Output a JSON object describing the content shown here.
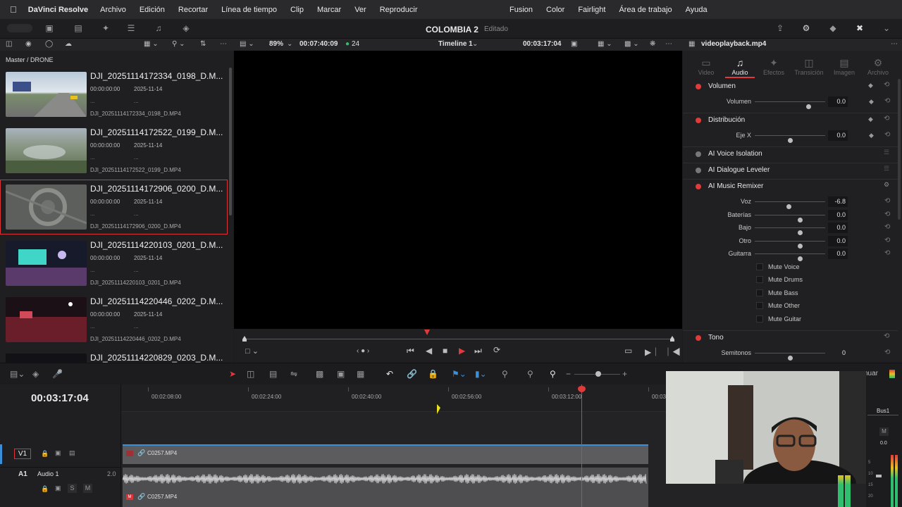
{
  "menubar": {
    "apple": "",
    "app": "DaVinci Resolve",
    "left_items": [
      "Archivo",
      "Edición",
      "Recortar",
      "Línea de tiempo",
      "Clip",
      "Marcar",
      "Ver",
      "Reproducir"
    ],
    "right_items": [
      "Fusion",
      "Color",
      "Fairlight",
      "Área de trabajo",
      "Ayuda"
    ]
  },
  "project": {
    "title": "COLOMBIA 2",
    "state": "Editado"
  },
  "viewer_bar": {
    "zoom": "89%",
    "source_tc": "00:07:40:09",
    "fps": "24",
    "timeline_name": "Timeline 1",
    "record_tc": "00:03:17:04",
    "clip_name": "videoplayback.mp4"
  },
  "mediapool": {
    "path": "Master / DRONE",
    "clips": [
      {
        "name": "DJI_20251114172334_0198_D.M...",
        "tc": "00:00:00:00",
        "date": "2025-11-14",
        "dash1": "...",
        "dash2": "...",
        "file": "DJI_20251114172334_0198_D.MP4",
        "selected": false
      },
      {
        "name": "DJI_20251114172522_0199_D.M...",
        "tc": "00:00:00:00",
        "date": "2025-11-14",
        "dash1": "...",
        "dash2": "...",
        "file": "DJI_20251114172522_0199_D.MP4",
        "selected": false
      },
      {
        "name": "DJI_20251114172906_0200_D.M...",
        "tc": "00:00:00:00",
        "date": "2025-11-14",
        "dash1": "...",
        "dash2": "...",
        "file": "DJI_20251114172906_0200_D.MP4",
        "selected": true
      },
      {
        "name": "DJI_20251114220103_0201_D.M...",
        "tc": "00:00:00:00",
        "date": "2025-11-14",
        "dash1": "...",
        "dash2": "...",
        "file": "DJI_20251114220103_0201_D.MP4",
        "selected": false
      },
      {
        "name": "DJI_20251114220446_0202_D.M...",
        "tc": "00:00:00:00",
        "date": "2025-11-14",
        "dash1": "...",
        "dash2": "...",
        "file": "DJI_20251114220446_0202_D.MP4",
        "selected": false
      },
      {
        "name": "DJI_20251114220829_0203_D.M...",
        "tc": "",
        "date": "",
        "dash1": "",
        "dash2": "",
        "file": "",
        "selected": false
      }
    ]
  },
  "inspector": {
    "tabs": [
      "Video",
      "Audio",
      "Efectos",
      "Transición",
      "Imagen",
      "Archivo"
    ],
    "active_tab": "Audio",
    "sections": {
      "volumen": {
        "title": "Volumen",
        "param": "Volumen",
        "value": "0.0",
        "level": 0.76
      },
      "distribucion": {
        "title": "Distribución",
        "param": "Eje X",
        "value": "0.0",
        "level": 0.5
      },
      "voice_isolation": "AI Voice Isolation",
      "dialogue_leveler": "AI Dialogue Leveler",
      "music_remixer": {
        "title": "AI Music Remixer",
        "params": [
          {
            "label": "Voz",
            "value": "-6.8",
            "level": 0.48
          },
          {
            "label": "Baterías",
            "value": "0.0",
            "level": 0.64
          },
          {
            "label": "Bajo",
            "value": "0.0",
            "level": 0.64
          },
          {
            "label": "Otro",
            "value": "0.0",
            "level": 0.64
          },
          {
            "label": "Guitarra",
            "value": "0.0",
            "level": 0.64
          }
        ],
        "mutes": [
          "Mute Voice",
          "Mute Drums",
          "Mute Bass",
          "Mute Other",
          "Mute Guitar"
        ]
      },
      "tono": {
        "title": "Tono",
        "param": "Semitonos",
        "value": "0",
        "level": 0.5
      }
    }
  },
  "timeline": {
    "timecode": "00:03:17:04",
    "ruler": [
      "00:02:08:00",
      "00:02:24:00",
      "00:02:40:00",
      "00:02:56:00",
      "00:03:12:00",
      "00:03"
    ],
    "video_track": {
      "id": "V1",
      "clip": "C0257.MP4"
    },
    "audio_track": {
      "id": "A1",
      "name": "Audio 1",
      "gain": "2.0",
      "clip": "C0257.MP4",
      "solo": "S",
      "mute": "M"
    },
    "toolbar_right_label": "nuar"
  },
  "mixer": {
    "bus": "Bus1",
    "mute": "M",
    "level": "0.0",
    "scale": [
      "5",
      "10",
      "15",
      "20"
    ]
  },
  "colors": {
    "accent_red": "#e23a3a",
    "selection": "#d8343a",
    "video_clip": "#5c5c5e",
    "audio_clip": "#4e4e50",
    "track_blue": "#3a8fd8"
  }
}
